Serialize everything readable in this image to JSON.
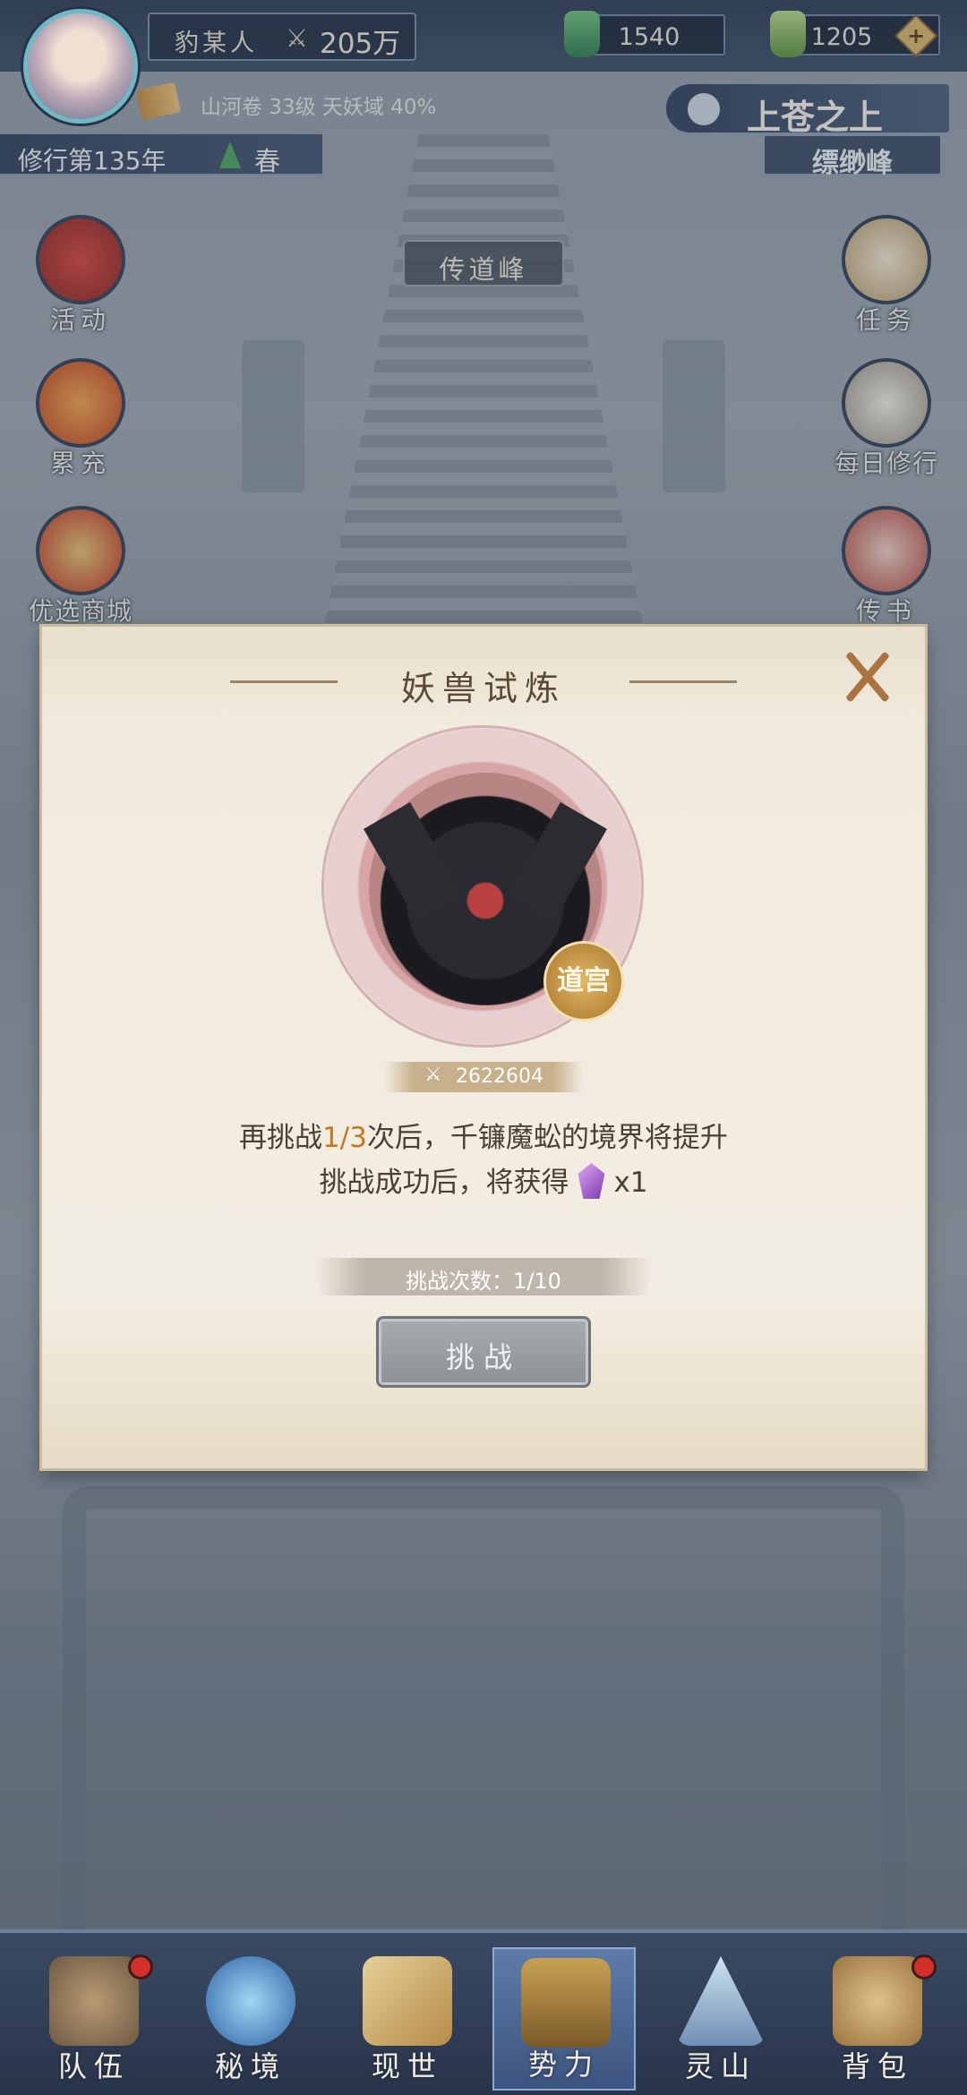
{
  "player": {
    "name": "豹某人",
    "power": "205万",
    "power_icon": "crossed-swords-icon"
  },
  "resources": [
    {
      "icon": "jade-icon",
      "value": "1540"
    },
    {
      "icon": "jade-token-icon",
      "value": "1205"
    }
  ],
  "progress_info": "山河卷 33级 天妖域 40%",
  "cultivation_year": "修行第135年",
  "season": "春",
  "realm": {
    "title": "上苍之上",
    "subtitle": "缥缈峰"
  },
  "location_label": "传道峰",
  "side_menu": {
    "left": [
      "活动",
      "累充",
      "优选商城"
    ],
    "right": [
      "任务",
      "每日修行",
      "传书"
    ]
  },
  "modal": {
    "title": "妖兽试炼",
    "rank_badge": "道宫",
    "beast_power": "2622604",
    "desc_line1_prefix": "再挑战",
    "desc_line1_progress": "1/3",
    "desc_line1_suffix": "次后，千镰魔蚣的境界将提升",
    "desc_line2_prefix": "挑战成功后，将获得",
    "reward_icon": "purple-crystal-icon",
    "reward_qty": "x1",
    "challenge_count": "挑战次数：1/10",
    "challenge_button": "挑战"
  },
  "bottom_nav": [
    {
      "label": "队伍",
      "icon": "team-icon",
      "badge": true,
      "active": false
    },
    {
      "label": "秘境",
      "icon": "vortex-icon",
      "badge": false,
      "active": false
    },
    {
      "label": "现世",
      "icon": "scroll-map-icon",
      "badge": false,
      "active": false
    },
    {
      "label": "势力",
      "icon": "palace-icon",
      "badge": false,
      "active": true
    },
    {
      "label": "灵山",
      "icon": "mountain-icon",
      "badge": false,
      "active": false
    },
    {
      "label": "背包",
      "icon": "bag-icon",
      "badge": true,
      "active": false
    }
  ],
  "colors": {
    "accent_gold": "#c3791f",
    "nav_bg": "#28344a",
    "modal_bg": "#f1ebde",
    "badge_red": "#d3302b"
  }
}
